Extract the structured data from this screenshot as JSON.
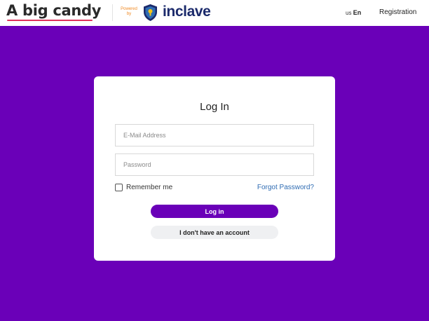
{
  "header": {
    "brand": "A big candy",
    "powered_by_line1": "Powered",
    "powered_by_line2": "by",
    "partner": "inclave",
    "lang_region": "us",
    "lang_code": "En",
    "registration": "Registration"
  },
  "login": {
    "title": "Log In",
    "email_placeholder": "E-Mail Address",
    "email_value": "",
    "password_placeholder": "Password",
    "password_value": "",
    "remember_label": "Remember me",
    "remember_checked": false,
    "forgot_label": "Forgot Password?",
    "login_button": "Log in",
    "no_account_button": "I don't have an account"
  },
  "colors": {
    "background": "#6a00b8",
    "primary": "#6a00b8",
    "brand_underline": "#e0315a",
    "partner_blue": "#1b2a6b",
    "link": "#2f6cb3"
  },
  "icons": {
    "partner_logo": "shield-icon"
  }
}
